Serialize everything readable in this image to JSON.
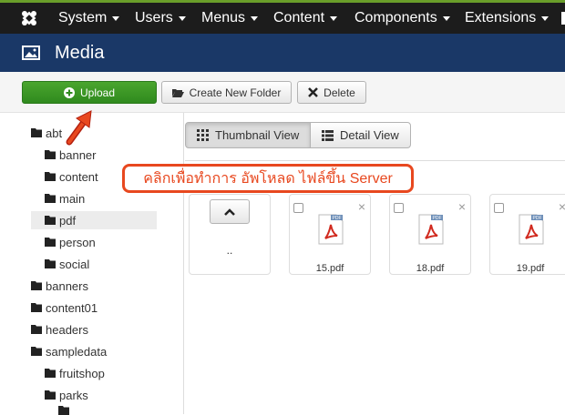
{
  "topbar": {
    "menu": [
      "System",
      "Users",
      "Menus",
      "Content",
      "Components",
      "Extensions"
    ],
    "colors": {
      "bar": "#1c1c1c",
      "accent": "#6a9e2a"
    }
  },
  "header": {
    "title": "Media",
    "icon": "image-icon",
    "color": "#1a3867"
  },
  "toolbar": {
    "upload": "Upload",
    "new_folder": "Create New Folder",
    "delete": "Delete"
  },
  "tree": [
    {
      "label": "abt",
      "level": 0
    },
    {
      "label": "banner",
      "level": 1
    },
    {
      "label": "content",
      "level": 1
    },
    {
      "label": "main",
      "level": 1
    },
    {
      "label": "pdf",
      "level": 1,
      "selected": true
    },
    {
      "label": "person",
      "level": 1
    },
    {
      "label": "social",
      "level": 1
    },
    {
      "label": "banners",
      "level": 0
    },
    {
      "label": "content01",
      "level": 0
    },
    {
      "label": "headers",
      "level": 0
    },
    {
      "label": "sampledata",
      "level": 0
    },
    {
      "label": "fruitshop",
      "level": 1
    },
    {
      "label": "parks",
      "level": 1
    }
  ],
  "views": {
    "thumbnail": "Thumbnail View",
    "detail": "Detail View"
  },
  "callout": "คลิกเพื่อทำการ อัพโหลด ไฟล์ขึ้น Server",
  "up_label": "..",
  "files": [
    "15.pdf",
    "18.pdf",
    "19.pdf"
  ]
}
